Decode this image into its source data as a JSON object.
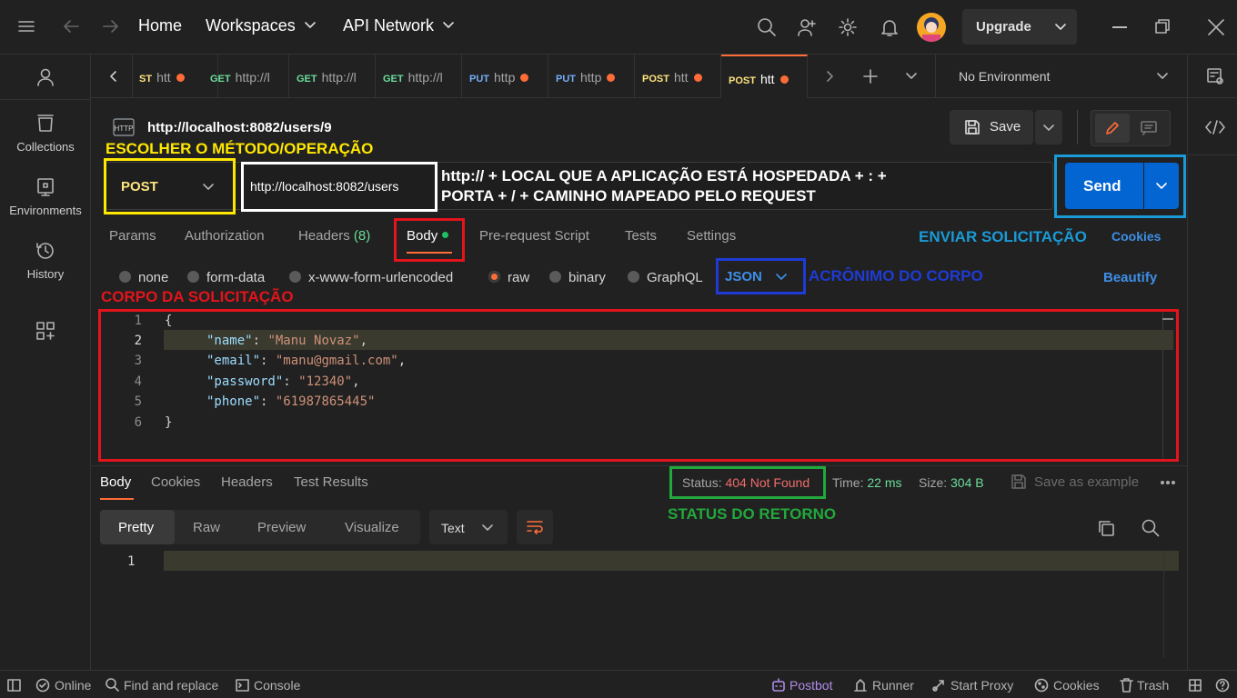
{
  "titlebar": {
    "home": "Home",
    "workspaces": "Workspaces",
    "api_network": "API Network",
    "upgrade": "Upgrade"
  },
  "sidebar": {
    "items": [
      {
        "label": "Collections"
      },
      {
        "label": "Environments"
      },
      {
        "label": "History"
      }
    ]
  },
  "tabs": [
    {
      "method": "ST",
      "text": "htt",
      "dot": true
    },
    {
      "method": "GET",
      "text": "http://l",
      "dot": false
    },
    {
      "method": "GET",
      "text": "http://l",
      "dot": false
    },
    {
      "method": "GET",
      "text": "http://l",
      "dot": false
    },
    {
      "method": "PUT",
      "text": "http",
      "dot": true
    },
    {
      "method": "PUT",
      "text": "http",
      "dot": true
    },
    {
      "method": "POST",
      "text": "htt",
      "dot": true
    },
    {
      "method": "POST",
      "text": "htt",
      "dot": true
    }
  ],
  "environment": "No Environment",
  "request": {
    "title": "http://localhost:8082/users/9",
    "save": "Save",
    "method": "POST",
    "url": "http://localhost:8082/users",
    "send": "Send",
    "subtabs": {
      "params": "Params",
      "authorization": "Authorization",
      "headers": "Headers",
      "headers_count": "(8)",
      "body": "Body",
      "prerequest": "Pre-request Script",
      "tests": "Tests",
      "settings": "Settings",
      "cookies": "Cookies"
    },
    "body_types": {
      "none": "none",
      "form_data": "form-data",
      "urlencoded": "x-www-form-urlencoded",
      "raw": "raw",
      "binary": "binary",
      "graphql": "GraphQL",
      "lang": "JSON",
      "beautify": "Beautify"
    },
    "code": {
      "line_numbers": [
        "1",
        "2",
        "3",
        "4",
        "5",
        "6"
      ],
      "open": "{",
      "close": "}",
      "fields": [
        {
          "key": "\"name\"",
          "value": "\"Manu Novaz\"",
          "sep": ","
        },
        {
          "key": "\"email\"",
          "value": "\"manu@gmail.com\"",
          "sep": ","
        },
        {
          "key": "\"password\"",
          "value": "\"12340\"",
          "sep": ","
        },
        {
          "key": "\"phone\"",
          "value": "\"61987865445\"",
          "sep": ""
        }
      ]
    }
  },
  "response": {
    "tabs": {
      "body": "Body",
      "cookies": "Cookies",
      "headers": "Headers",
      "tests": "Test Results"
    },
    "status_label": "Status:",
    "status_value": "404 Not Found",
    "time_label": "Time:",
    "time_value": "22 ms",
    "size_label": "Size:",
    "size_value": "304 B",
    "save_example": "Save as example",
    "views": {
      "pretty": "Pretty",
      "raw": "Raw",
      "preview": "Preview",
      "visualize": "Visualize",
      "format": "Text"
    },
    "line_number": "1"
  },
  "annotations": {
    "method": "ESCOLHER O MÉTODO/OPERAÇÃO",
    "url_line1": "http:// + LOCAL QUE A APLICAÇÃO ESTÁ HOSPEDADA + : +",
    "url_line2": "PORTA + / + CAMINHO MAPEADO PELO REQUEST",
    "send": "ENVIAR SOLICITAÇÃO",
    "lang": "ACRÔNIMO DO CORPO",
    "body": "CORPO DA SOLICITAÇÃO",
    "status": "STATUS DO RETORNO",
    "colors": {
      "yellow": "#ffe800",
      "white": "#ffffff",
      "blue_send": "#1a9ad6",
      "red": "#e3141b",
      "blue": "#1f3bd6",
      "green": "#22a83c"
    }
  },
  "statusbar": {
    "online": "Online",
    "find": "Find and replace",
    "console": "Console",
    "postbot": "Postbot",
    "runner": "Runner",
    "proxy": "Start Proxy",
    "cookies": "Cookies",
    "trash": "Trash"
  }
}
